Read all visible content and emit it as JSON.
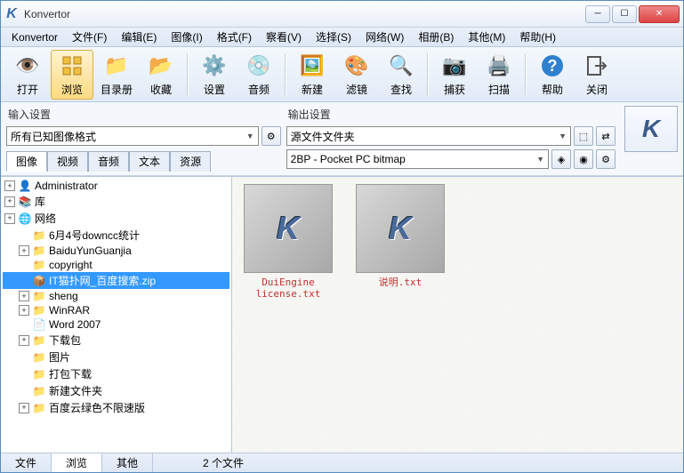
{
  "window": {
    "title": "Konvertor"
  },
  "menu": {
    "items": [
      "Konvertor",
      "文件(F)",
      "编辑(E)",
      "图像(I)",
      "格式(F)",
      "察看(V)",
      "选择(S)",
      "网络(W)",
      "相册(B)",
      "其他(M)",
      "帮助(H)"
    ]
  },
  "toolbar": {
    "open": "打开",
    "browse": "浏览",
    "catalog": "目录册",
    "favorites": "收藏",
    "settings": "设置",
    "audio": "音频",
    "new": "新建",
    "filter": "滤镜",
    "find": "查找",
    "capture": "捕获",
    "scan": "扫描",
    "help": "帮助",
    "close": "关闭"
  },
  "input_settings": {
    "label": "输入设置",
    "format": "所有已知图像格式",
    "tabs": [
      "图像",
      "视频",
      "音频",
      "文本",
      "资源"
    ]
  },
  "output_settings": {
    "label": "输出设置",
    "folder": "源文件文件夹",
    "format": "2BP - Pocket PC bitmap"
  },
  "tree": {
    "items": [
      {
        "label": "Administrator",
        "icon": "user",
        "depth": 0,
        "expand": "+"
      },
      {
        "label": "库",
        "icon": "lib",
        "depth": 0,
        "expand": "+"
      },
      {
        "label": "网络",
        "icon": "net",
        "depth": 0,
        "expand": "+"
      },
      {
        "label": "6月4号downcc统计",
        "icon": "folder",
        "depth": 1,
        "expand": ""
      },
      {
        "label": "BaiduYunGuanjia",
        "icon": "folder",
        "depth": 1,
        "expand": "+"
      },
      {
        "label": "copyright",
        "icon": "folder",
        "depth": 1,
        "expand": ""
      },
      {
        "label": "IT猫扑网_百度搜索.zip",
        "icon": "zip",
        "depth": 1,
        "expand": "",
        "selected": true
      },
      {
        "label": "sheng",
        "icon": "folder",
        "depth": 1,
        "expand": "+"
      },
      {
        "label": "WinRAR",
        "icon": "folder",
        "depth": 1,
        "expand": "+"
      },
      {
        "label": "Word 2007",
        "icon": "word",
        "depth": 1,
        "expand": ""
      },
      {
        "label": "下载包",
        "icon": "folder",
        "depth": 1,
        "expand": "+"
      },
      {
        "label": "图片",
        "icon": "folder",
        "depth": 1,
        "expand": ""
      },
      {
        "label": "打包下载",
        "icon": "folder",
        "depth": 1,
        "expand": ""
      },
      {
        "label": "新建文件夹",
        "icon": "folder",
        "depth": 1,
        "expand": ""
      },
      {
        "label": "百度云绿色不限速版",
        "icon": "folder",
        "depth": 1,
        "expand": "+"
      }
    ]
  },
  "thumbs": [
    {
      "label": "DuiEngine\nlicense.txt"
    },
    {
      "label": "说明.txt"
    }
  ],
  "status": {
    "tabs": [
      "文件",
      "浏览",
      "其他"
    ],
    "info": "2 个文件"
  }
}
